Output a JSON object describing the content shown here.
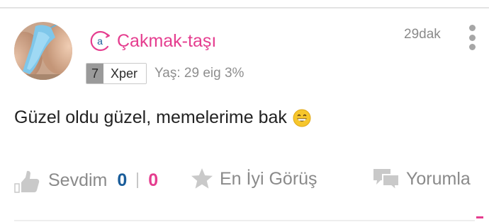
{
  "post": {
    "username": "Çakmak-taşı",
    "anon_badge_letter": "a",
    "timestamp": "29dak",
    "level": {
      "number": "7",
      "label": "Xper"
    },
    "meta": "Yaş: 29 eig 3%",
    "comment": "Güzel oldu güzel, memelerime bak",
    "comment_emoji": "grinning-face"
  },
  "actions": {
    "like_label": "Sevdim",
    "like_count": "0",
    "dislike_count": "0",
    "best_label": "En İyi Görüş",
    "reply_label": "Yorumla"
  },
  "colors": {
    "accent_pink": "#e53d8f",
    "accent_blue": "#1a5d9a",
    "muted_gray": "#8a8a8a",
    "icon_gray": "#c9c9c9"
  },
  "icons": {
    "avatar": "user-photo-avatar",
    "anon_badge": "anonymous-a-badge-icon",
    "more": "vertical-ellipsis-icon",
    "like": "thumbs-up-icon",
    "best": "star-icon",
    "reply": "speech-bubbles-icon"
  }
}
